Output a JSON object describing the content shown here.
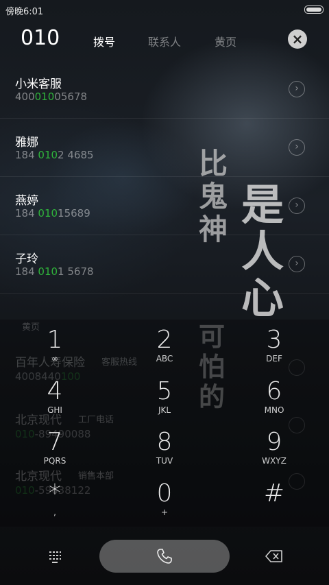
{
  "status_bar": {
    "time": "傍晚6:01"
  },
  "header": {
    "dial_number": "010",
    "tabs": [
      {
        "label": "拨号",
        "active": true
      },
      {
        "label": "联系人",
        "active": false
      },
      {
        "label": "黄页",
        "active": false
      }
    ],
    "close_icon": "close-icon"
  },
  "contacts": [
    {
      "name": "小米客服",
      "number_pre": "400",
      "number_match": "010",
      "number_post": "05678"
    },
    {
      "name": "雅娜",
      "number_pre": "184 ",
      "number_match": "010",
      "number_post": "2 4685"
    },
    {
      "name": "燕婷",
      "number_pre": "184 ",
      "number_match": "010",
      "number_post": "15689"
    },
    {
      "name": "子玲",
      "number_pre": "184 ",
      "number_match": "010",
      "number_post": "1 5678"
    }
  ],
  "yellow_pages": {
    "header": "黄页",
    "items": [
      {
        "name": "百年人寿保险",
        "tag": "客服热线",
        "number_pre": "4008440",
        "number_match": "100",
        "number_post": ""
      },
      {
        "name": "北京现代",
        "tag": "工厂电话",
        "number_pre": "",
        "number_match": "010",
        "number_post": "-89490088"
      },
      {
        "name": "北京现代",
        "tag": "销售本部",
        "number_pre": "",
        "number_match": "010",
        "number_post": "-59638122"
      }
    ]
  },
  "poster_text": {
    "col1": [
      "比",
      "鬼",
      "神"
    ],
    "col2": [
      "是",
      "人",
      "心"
    ],
    "col3": [
      "可",
      "怕",
      "的"
    ]
  },
  "keypad": [
    {
      "digit": "1",
      "letters": "∞"
    },
    {
      "digit": "2",
      "letters": "ABC"
    },
    {
      "digit": "3",
      "letters": "DEF"
    },
    {
      "digit": "4",
      "letters": "GHI"
    },
    {
      "digit": "5",
      "letters": "JKL"
    },
    {
      "digit": "6",
      "letters": "MNO"
    },
    {
      "digit": "7",
      "letters": "PQRS"
    },
    {
      "digit": "8",
      "letters": "TUV"
    },
    {
      "digit": "9",
      "letters": "WXYZ"
    },
    {
      "digit": "*",
      "letters": ","
    },
    {
      "digit": "0",
      "letters": "+"
    },
    {
      "digit": "#",
      "letters": ""
    }
  ],
  "bottom_bar": {
    "left_icon": "dialpad-toggle-icon",
    "call_icon": "phone-icon",
    "right_icon": "backspace-icon"
  },
  "colors": {
    "match_highlight": "#2fb33b",
    "call_button": "#8a8a8a"
  }
}
